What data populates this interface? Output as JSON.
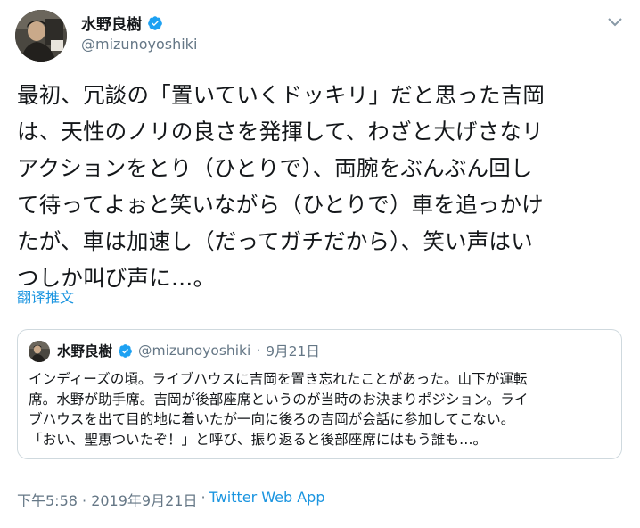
{
  "author": {
    "display_name": "水野良樹",
    "handle": "@mizunoyoshiki"
  },
  "tweet": {
    "text": "最初、冗談の「置いていくドッキリ」だと思った吉岡\nは、天性のノリの良さを発揮して、わざと大げさなリ\nアクションをとり（ひとりで）、両腕をぶんぶん回し\nて待ってよぉと笑いながら（ひとりで）車を追っかけ\nたが、車は加速し（だってガチだから）、笑い声はい\nつしか叫び声に…。",
    "translate_label": "翻译推文",
    "timestamp": "下午5:58 · 2019年9月21日",
    "separator": "·",
    "source": "Twitter Web App"
  },
  "quote": {
    "display_name": "水野良樹",
    "handle": "@mizunoyoshiki",
    "separator": "·",
    "date": "9月21日",
    "text": "インディーズの頃。ライブハウスに吉岡を置き忘れたことがあった。山下が運転\n席。水野が助手席。吉岡が後部座席というのが当時のお決まりポジション。ライ\nブハウスを出て目的地に着いたが一向に後ろの吉岡が会話に参加してこない。\n「おい、聖恵ついたぞ！」と呼び、振り返ると後部座席にはもう誰も…。"
  },
  "icons": {
    "verified": "verified-badge-icon",
    "menu": "chevron-down-icon"
  },
  "colors": {
    "link": "#1b95e0",
    "secondary": "#657786",
    "verified": "#1da1f2"
  }
}
